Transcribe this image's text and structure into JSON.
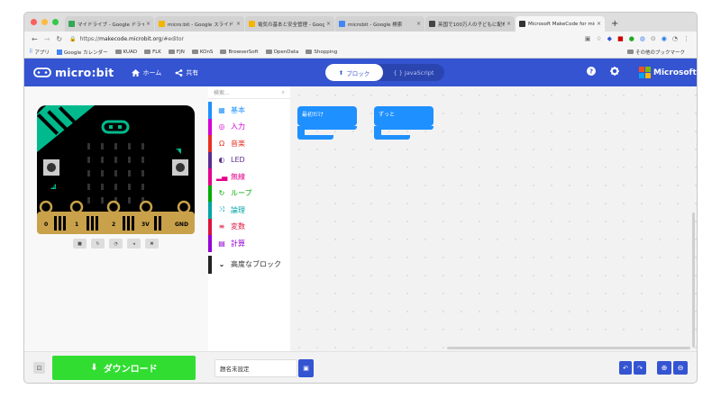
{
  "browser": {
    "tabs": [
      {
        "title": "マイドライブ - Google ドライブ",
        "favicon_color": "#34a853",
        "active": false
      },
      {
        "title": "micro:bit - Google スライド",
        "favicon_color": "#f4b400",
        "active": false
      },
      {
        "title": "電気の基本と安全管理 - Google",
        "favicon_color": "#f4b400",
        "active": false
      },
      {
        "title": "microbit - Google 検索",
        "favicon_color": "#4285f4",
        "active": false
      },
      {
        "title": "英国で100万人の子どもに配布さ",
        "favicon_color": "#444444",
        "active": false
      },
      {
        "title": "Microsoft MakeCode for micro",
        "favicon_color": "#333333",
        "active": true
      }
    ],
    "new_tab_label": "+",
    "url_prefix": "https://",
    "url_host": "makecode.microbit.org",
    "url_path": "/#editor",
    "bookmarks": [
      "アプリ",
      "Google カレンダー",
      "KUAD",
      "FLK",
      "FJN",
      "KOnS",
      "BrowserSoft",
      "OpenData",
      "Shopping"
    ],
    "bookmarks_right": "その他のブックマーク"
  },
  "header": {
    "brand": "micro:bit",
    "home_label": "ホーム",
    "share_label": "共有",
    "blocks_label": "ブロック",
    "js_label": "{ } JavaScript",
    "microsoft_label": "Microsoft",
    "accent": "#3454d1"
  },
  "toolbox": {
    "search_placeholder": "検索...",
    "categories": [
      {
        "label": "基本",
        "color": "#1e90ff",
        "icon": "grid"
      },
      {
        "label": "入力",
        "color": "#d400d4",
        "icon": "target"
      },
      {
        "label": "音楽",
        "color": "#e63022",
        "icon": "headphones"
      },
      {
        "label": "LED",
        "color": "#5c2d91",
        "icon": "toggle"
      },
      {
        "label": "無線",
        "color": "#e3008c",
        "icon": "signal"
      },
      {
        "label": "ループ",
        "color": "#00aa00",
        "icon": "refresh"
      },
      {
        "label": "論理",
        "color": "#00a4a6",
        "icon": "shuffle"
      },
      {
        "label": "変数",
        "color": "#dc143c",
        "icon": "lines"
      },
      {
        "label": "計算",
        "color": "#9400d3",
        "icon": "calculator"
      }
    ],
    "advanced_label": "高度なブロック"
  },
  "workspace": {
    "block_on_start": "最初だけ",
    "block_forever": "ずっと"
  },
  "simulator": {
    "pins": [
      "0",
      "1",
      "2",
      "3V",
      "GND"
    ],
    "button_a": "A",
    "button_b": "B"
  },
  "bottom": {
    "download_label": "ダウンロード",
    "project_name": "題名未設定",
    "download_color": "#31dd31"
  }
}
